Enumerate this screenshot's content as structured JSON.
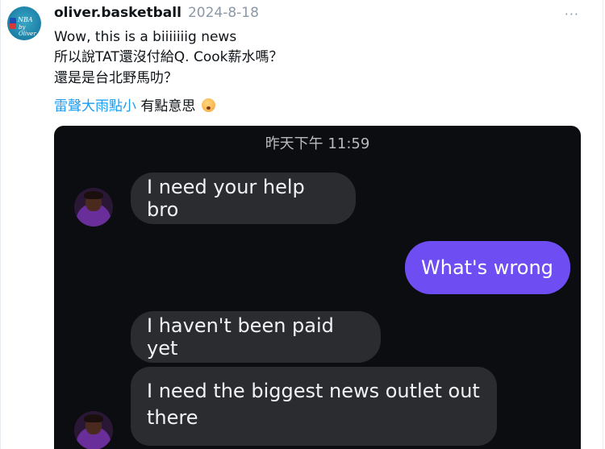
{
  "post": {
    "username": "oliver.basketball",
    "date": "2024-8-18",
    "more_label": "···",
    "avatar_text_1": "NBA",
    "avatar_text_2": "by Oliver",
    "lines": [
      "Wow, this is a biiiiiiig news",
      "所以說TAT還沒付給Q. Cook薪水嗎？",
      "還是是台北野馬叻？"
    ],
    "mention": "雷聲大雨點小",
    "mention_suffix": " 有點意思"
  },
  "chat": {
    "time": "昨天下午 11:59",
    "messages": [
      {
        "side": "left",
        "text": "I need your help bro"
      },
      {
        "side": "right",
        "text": "What's wrong"
      },
      {
        "side": "left",
        "text": "I haven't been paid yet"
      },
      {
        "side": "left",
        "text": "I need the biggest news outlet out there"
      }
    ]
  },
  "colors": {
    "mention": "#1d9bf0",
    "sent_bubble": "#6e4ef2",
    "received_bubble": "#2b2c30",
    "chat_background": "#0c0d11"
  }
}
